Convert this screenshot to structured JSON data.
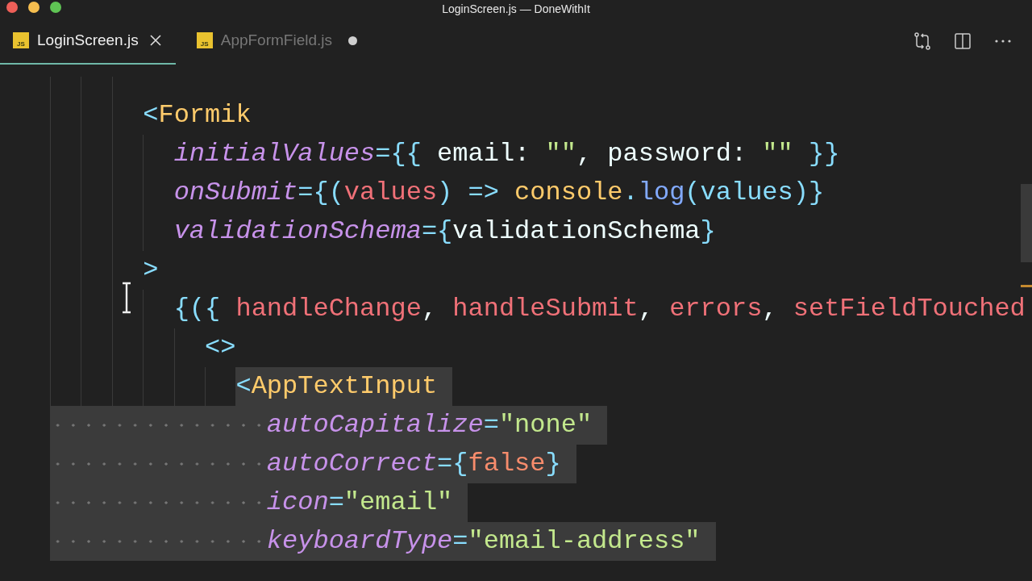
{
  "window": {
    "title": "LoginScreen.js — DoneWithIt"
  },
  "tabs": [
    {
      "label": "LoginScreen.js",
      "icon_text": "JS",
      "selected": true,
      "dirty": false
    },
    {
      "label": "AppFormField.js",
      "icon_text": "JS",
      "selected": false,
      "dirty": true
    }
  ],
  "editor": {
    "lines": [
      {
        "selected": false,
        "indent_selected": false,
        "tokens": [
          {
            "text": "      <",
            "kind": "punct"
          },
          {
            "text": "Formik",
            "kind": "component"
          }
        ]
      },
      {
        "selected": false,
        "indent_selected": false,
        "tokens": [
          {
            "text": "        initialValues",
            "kind": "attr"
          },
          {
            "text": "={{",
            "kind": "punct"
          },
          {
            "text": " email: ",
            "kind": "plain"
          },
          {
            "text": "\"\"",
            "kind": "string"
          },
          {
            "text": ", password: ",
            "kind": "plain"
          },
          {
            "text": "\"\"",
            "kind": "string"
          },
          {
            "text": " }}",
            "kind": "punct"
          }
        ]
      },
      {
        "selected": false,
        "indent_selected": false,
        "tokens": [
          {
            "text": "        onSubmit",
            "kind": "attr"
          },
          {
            "text": "={(",
            "kind": "punct"
          },
          {
            "text": "values",
            "kind": "variable"
          },
          {
            "text": ") => ",
            "kind": "punct"
          },
          {
            "text": "console",
            "kind": "component"
          },
          {
            "text": ".",
            "kind": "punct"
          },
          {
            "text": "log",
            "kind": "function"
          },
          {
            "text": "(values)}",
            "kind": "punct"
          }
        ]
      },
      {
        "selected": false,
        "indent_selected": false,
        "tokens": [
          {
            "text": "        validationSchema",
            "kind": "attr"
          },
          {
            "text": "={",
            "kind": "punct"
          },
          {
            "text": "validationSchema",
            "kind": "plain"
          },
          {
            "text": "}",
            "kind": "punct"
          }
        ]
      },
      {
        "selected": false,
        "indent_selected": false,
        "tokens": [
          {
            "text": "      >",
            "kind": "punct"
          }
        ]
      },
      {
        "selected": false,
        "indent_selected": false,
        "tokens": [
          {
            "text": "        {({ ",
            "kind": "punct"
          },
          {
            "text": "handleChange",
            "kind": "variable"
          },
          {
            "text": ", ",
            "kind": "plain"
          },
          {
            "text": "handleSubmit",
            "kind": "variable"
          },
          {
            "text": ", ",
            "kind": "plain"
          },
          {
            "text": "errors",
            "kind": "variable"
          },
          {
            "text": ", ",
            "kind": "plain"
          },
          {
            "text": "setFieldTouched",
            "kind": "variable"
          }
        ]
      },
      {
        "selected": false,
        "indent_selected": false,
        "tokens": [
          {
            "text": "          <>",
            "kind": "punct"
          }
        ]
      },
      {
        "selected": true,
        "indent_selected": false,
        "tokens": [
          {
            "text": "            <",
            "kind": "punct"
          },
          {
            "text": "AppTextInput",
            "kind": "component"
          }
        ]
      },
      {
        "selected": true,
        "indent_selected": true,
        "tokens": [
          {
            "text": "              autoCapitalize",
            "kind": "attr"
          },
          {
            "text": "=",
            "kind": "punct"
          },
          {
            "text": "\"none\"",
            "kind": "string"
          }
        ]
      },
      {
        "selected": true,
        "indent_selected": true,
        "tokens": [
          {
            "text": "              autoCorrect",
            "kind": "attr"
          },
          {
            "text": "={",
            "kind": "punct"
          },
          {
            "text": "false",
            "kind": "constant"
          },
          {
            "text": "}",
            "kind": "punct"
          }
        ]
      },
      {
        "selected": true,
        "indent_selected": true,
        "tokens": [
          {
            "text": "              icon",
            "kind": "attr"
          },
          {
            "text": "=",
            "kind": "punct"
          },
          {
            "text": "\"email\"",
            "kind": "string"
          }
        ]
      },
      {
        "selected": true,
        "indent_selected": true,
        "tokens": [
          {
            "text": "              keyboardType",
            "kind": "attr"
          },
          {
            "text": "=",
            "kind": "punct"
          },
          {
            "text": "\"email-address\"",
            "kind": "string"
          }
        ]
      }
    ]
  }
}
